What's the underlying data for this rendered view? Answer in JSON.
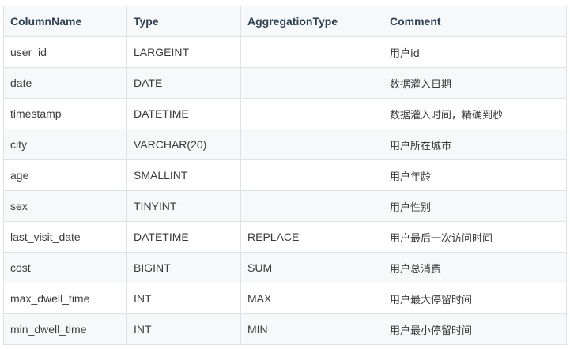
{
  "table": {
    "headers": [
      "ColumnName",
      "Type",
      "AggregationType",
      "Comment"
    ],
    "rows": [
      [
        "user_id",
        "LARGEINT",
        "",
        "用户id"
      ],
      [
        "date",
        "DATE",
        "",
        "数据灌入日期"
      ],
      [
        "timestamp",
        "DATETIME",
        "",
        "数据灌入时间，精确到秒"
      ],
      [
        "city",
        "VARCHAR(20)",
        "",
        "用户所在城市"
      ],
      [
        "age",
        "SMALLINT",
        "",
        "用户年龄"
      ],
      [
        "sex",
        "TINYINT",
        "",
        "用户性别"
      ],
      [
        "last_visit_date",
        "DATETIME",
        "REPLACE",
        "用户最后一次访问时间"
      ],
      [
        "cost",
        "BIGINT",
        "SUM",
        "用户总消费"
      ],
      [
        "max_dwell_time",
        "INT",
        "MAX",
        "用户最大停留时间"
      ],
      [
        "min_dwell_time",
        "INT",
        "MIN",
        "用户最小停留时间"
      ]
    ]
  }
}
